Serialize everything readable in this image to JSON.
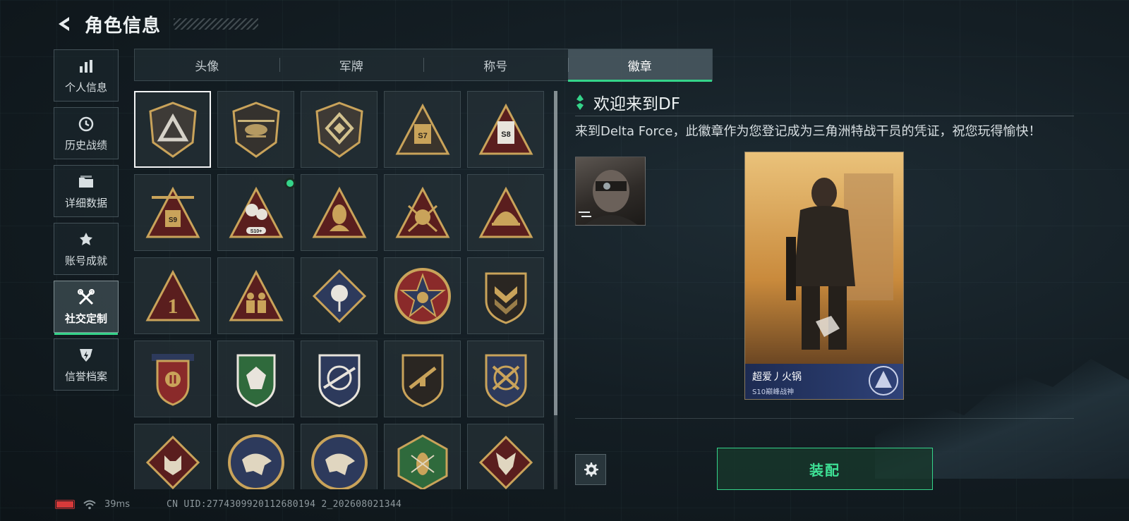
{
  "header": {
    "title": "角色信息",
    "back_icon": "back-arrow-icon"
  },
  "sidebar": {
    "items": [
      {
        "label": "个人信息",
        "icon": "bar-chart-icon",
        "active": false
      },
      {
        "label": "历史战绩",
        "icon": "clock-icon",
        "active": false
      },
      {
        "label": "详细数据",
        "icon": "folder-icon",
        "active": false
      },
      {
        "label": "账号成就",
        "icon": "achievement-icon",
        "active": false
      },
      {
        "label": "社交定制",
        "icon": "tools-icon",
        "active": true
      },
      {
        "label": "信誉档案",
        "icon": "shield-bolt-icon",
        "active": false
      }
    ]
  },
  "tabs": [
    {
      "label": "头像",
      "active": false
    },
    {
      "label": "军牌",
      "active": false
    },
    {
      "label": "称号",
      "active": false
    },
    {
      "label": "徽章",
      "active": true
    }
  ],
  "badges": {
    "rows": [
      [
        "triangle-emblem-badge",
        "helicopter-badge",
        "diamond-shield-badge",
        "s7-triangle-badge",
        "s8-triangle-badge"
      ],
      [
        "s9-triangle-badge",
        "s10-triangle-badge",
        "mask-figure-badge",
        "skull-blades-badge",
        "helmet-badge"
      ],
      [
        "number-one-badge",
        "soldiers-badge",
        "rose-badge",
        "star-circle-badge",
        "chevron-shield-badge"
      ],
      [
        "laurel-shield-badge",
        "green-gem-badge",
        "crosshair-rifle-badge",
        "rifle-shield-badge",
        "crossed-guns-badge"
      ],
      [
        "wolf-diamond-badge",
        "eagle-circle-badge",
        "eagle-circle-badge-2",
        "wasp-hexagon-badge",
        "dragon-diamond-badge"
      ]
    ],
    "selected": "triangle-emblem-badge",
    "new_indicator": "s10-triangle-badge",
    "labels": {
      "s7": "S7",
      "s8": "S8",
      "s9": "S9",
      "s10": "S10+",
      "one": "1"
    }
  },
  "detail": {
    "title": "欢迎来到DF",
    "description": "来到Delta Force，此徽章作为您登记成为三角洲特战干员的凭证，祝您玩得愉快！",
    "card": {
      "player_name": "超爱丿火锅",
      "player_title": "S10巅峰战神"
    }
  },
  "actions": {
    "equip_label": "装配",
    "settings_icon": "gear-icon"
  },
  "status": {
    "ping": "39ms",
    "uid": "CN UID:2774309920112680194 2_202608021344"
  },
  "colors": {
    "accent": "#35d48a",
    "gold": "#c9a35a",
    "badge_dark": "#3a3530",
    "battery_low": "#d83a3a"
  }
}
